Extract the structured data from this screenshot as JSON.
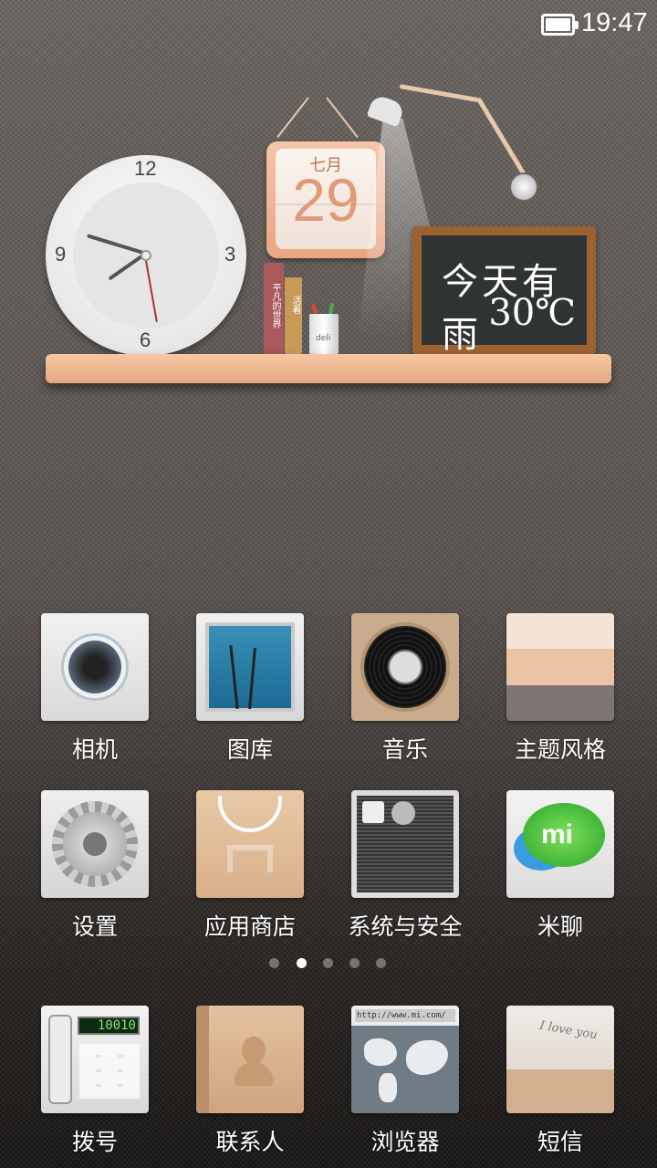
{
  "status_bar": {
    "time": "19:47",
    "battery_icon": "battery-full-icon"
  },
  "widget": {
    "clock": {
      "numbers": [
        "12",
        "3",
        "6",
        "9"
      ]
    },
    "calendar": {
      "month": "七月",
      "day": "29"
    },
    "books": [
      "平凡的世界",
      "活着"
    ],
    "pencil_cup_brand": "deli",
    "blackboard": {
      "line1": "今天有雨",
      "line2": "30℃"
    }
  },
  "apps": [
    {
      "label": "相机",
      "icon": "camera-icon"
    },
    {
      "label": "图库",
      "icon": "gallery-icon"
    },
    {
      "label": "音乐",
      "icon": "music-icon"
    },
    {
      "label": "主题风格",
      "icon": "theme-icon"
    },
    {
      "label": "设置",
      "icon": "settings-icon"
    },
    {
      "label": "应用商店",
      "icon": "app-store-icon"
    },
    {
      "label": "系统与安全",
      "icon": "system-security-icon"
    },
    {
      "label": "米聊",
      "icon": "miliao-icon"
    }
  ],
  "page_indicator": {
    "count": 5,
    "active": 1
  },
  "dock": [
    {
      "label": "拨号",
      "icon": "phone-icon",
      "display": "10010"
    },
    {
      "label": "联系人",
      "icon": "contacts-icon"
    },
    {
      "label": "浏览器",
      "icon": "browser-icon",
      "url": "http://www.mi.com/"
    },
    {
      "label": "短信",
      "icon": "messages-icon",
      "note": "I love you"
    }
  ],
  "colors": {
    "shelf": "#f2bb95",
    "accent": "#e09a78"
  }
}
